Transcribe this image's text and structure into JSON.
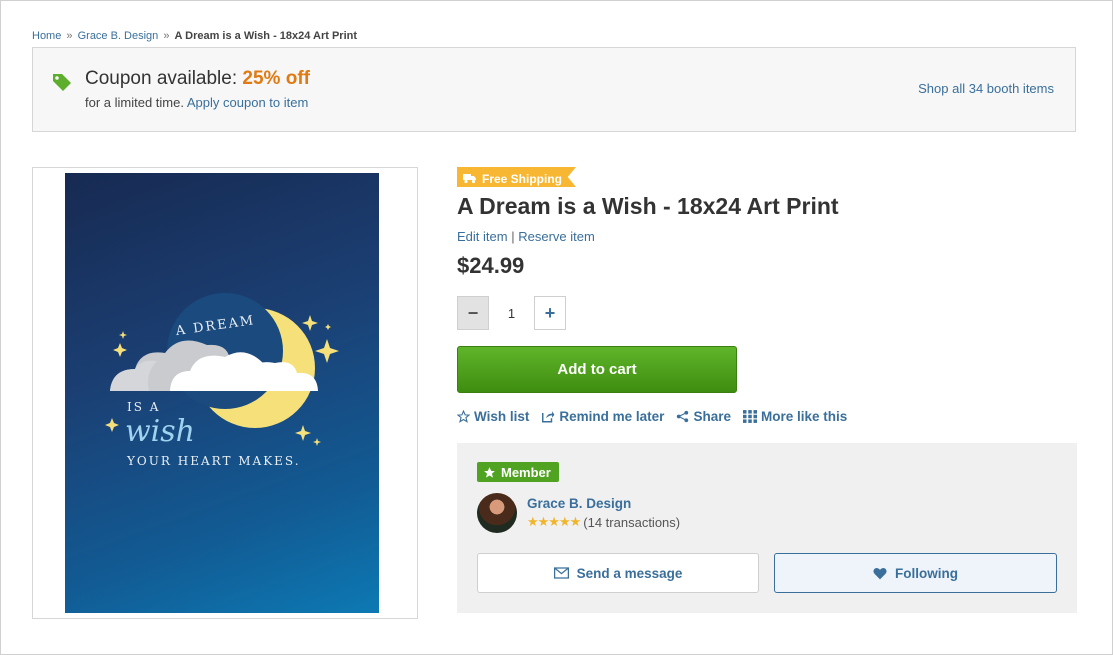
{
  "breadcrumb": {
    "home": "Home",
    "booth": "Grace B. Design",
    "current": "A Dream is a Wish - 18x24 Art Print",
    "separator": "»"
  },
  "coupon": {
    "title_prefix": "Coupon available:",
    "percent": "25% off",
    "sub_prefix": "for a limited time.",
    "apply_link": "Apply coupon to item",
    "shop_all": "Shop all 34 booth items",
    "icon": "tag-icon"
  },
  "artwork": {
    "line1": "A DREAM",
    "line2": "IS A",
    "line3": "wish",
    "line4": "YOUR HEART MAKES."
  },
  "product": {
    "badge": "Free Shipping",
    "title": "A Dream is a Wish - 18x24 Art Print",
    "edit_link": "Edit item",
    "divider": "|",
    "reserve_link": "Reserve item",
    "price": "$24.99",
    "quantity": "1",
    "minus": "−",
    "plus": "+",
    "add_to_cart": "Add to cart"
  },
  "actions": {
    "wishlist": "Wish list",
    "remind": "Remind me later",
    "share": "Share",
    "more": "More like this"
  },
  "seller": {
    "badge": "Member",
    "name": "Grace B. Design",
    "rating_stars": "★★★★★",
    "transactions": "(14 transactions)",
    "send_message": "Send a message",
    "following": "Following"
  },
  "colors": {
    "link": "#3a6f9b",
    "coupon_accent": "#e07a13",
    "cart_green": "#4fa320",
    "shipping_badge": "#f7b733",
    "star": "#f1b52b"
  }
}
